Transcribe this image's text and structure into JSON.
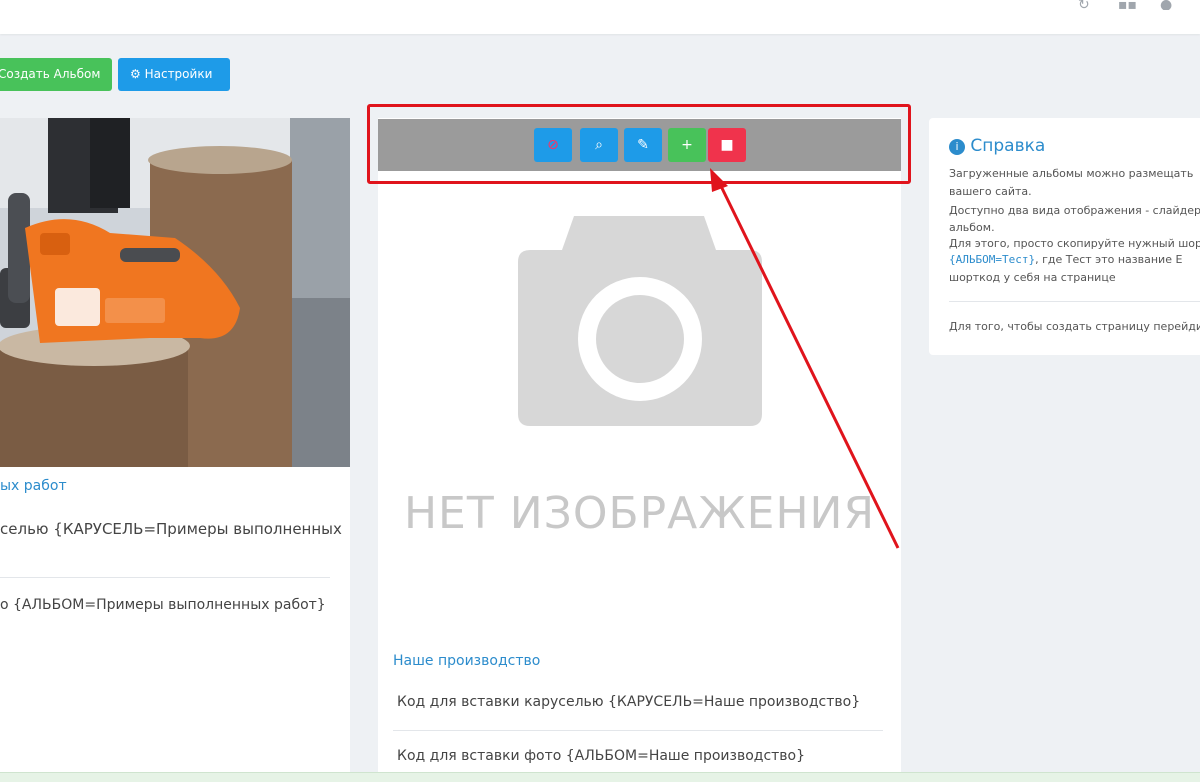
{
  "toolbar": {
    "create_album_label": "Создать Альбом",
    "settings_label": "Настройки"
  },
  "album_left": {
    "title": "ых работ",
    "carousel_code": "селью {КАРУСЕЛЬ=Примеры выполненных",
    "album_code": "о {АЛЬБОМ=Примеры выполненных работ}"
  },
  "album_mid": {
    "no_image_text": "НЕТ ИЗОБРАЖЕНИЯ",
    "title": "Наше производство",
    "carousel_code": "Код для вставки каруселью {КАРУСЕЛЬ=Наше производство}",
    "album_code": "Код для вставки фото {АЛЬБОМ=Наше производство}",
    "action_icons": [
      "eye-slash-icon",
      "search-icon",
      "edit-icon",
      "plus-icon",
      "trash-icon"
    ]
  },
  "help": {
    "title": "Справка",
    "line1": "Загруженные альбомы можно размещать",
    "line2": "вашего сайта.",
    "line3": "Доступно два вида отображения - слайдер",
    "line4": "альбом.",
    "line5": "Для этого, просто скопируйте нужный шор",
    "line6_code": "{АЛЬБОМ=Тест}",
    "line6_rest": ", где Тест это название E",
    "line7": "шорткод у себя на странице",
    "line8": "Для того, чтобы создать страницу перейди"
  },
  "colors": {
    "green": "#48c25a",
    "blue": "#1e9be8",
    "red": "#f0334c",
    "highlight": "#e0141c",
    "link": "#2c8ccc"
  }
}
